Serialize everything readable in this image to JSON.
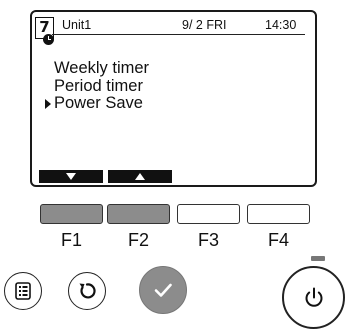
{
  "header": {
    "unit_badge": "7",
    "unit_name": "Unit1",
    "date": "9/ 2 FRI",
    "time": "14:30"
  },
  "menu": {
    "items": [
      {
        "label": "Weekly timer",
        "selected": false
      },
      {
        "label": "Period timer",
        "selected": false
      },
      {
        "label": "Power Save",
        "selected": true
      }
    ]
  },
  "softkeys": [
    {
      "icon": "triangle-down-icon"
    },
    {
      "icon": "triangle-up-icon"
    }
  ],
  "function_keys": [
    {
      "label": "F1",
      "active": true
    },
    {
      "label": "F2",
      "active": true
    },
    {
      "label": "F3",
      "active": false
    },
    {
      "label": "F4",
      "active": false
    }
  ],
  "buttons": {
    "menu_icon": "menu-list-icon",
    "back_icon": "return-icon",
    "confirm_icon": "checkmark-icon",
    "power_icon": "power-icon"
  },
  "colors": {
    "lcd_border": "#1a1a1a",
    "key_active": "#8c8c8c",
    "softkey_bar": "#111111"
  }
}
